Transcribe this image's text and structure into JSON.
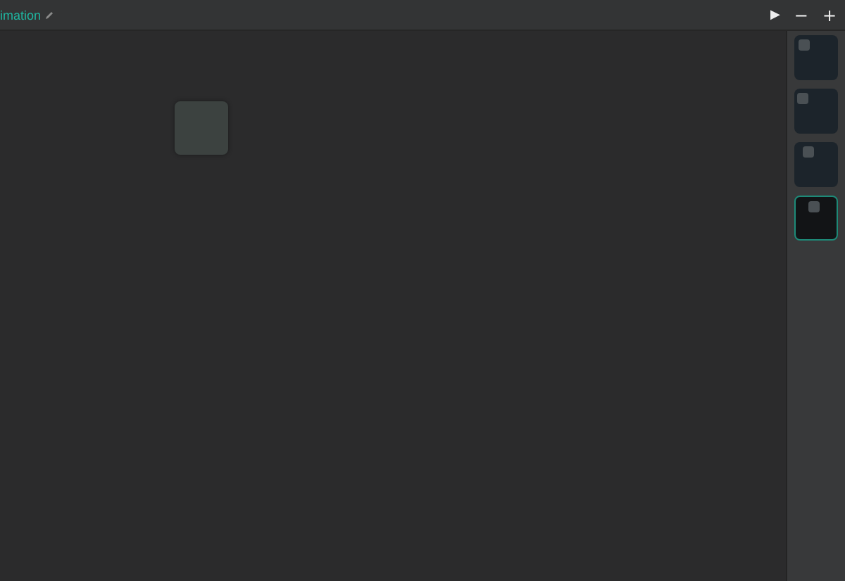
{
  "toolbar": {
    "title": "imation",
    "play_button": "▶",
    "zoom_out_button": "−",
    "zoom_in_button": "+"
  },
  "frames": [
    {
      "selected": false
    },
    {
      "selected": false
    },
    {
      "selected": false
    },
    {
      "selected": true
    }
  ]
}
